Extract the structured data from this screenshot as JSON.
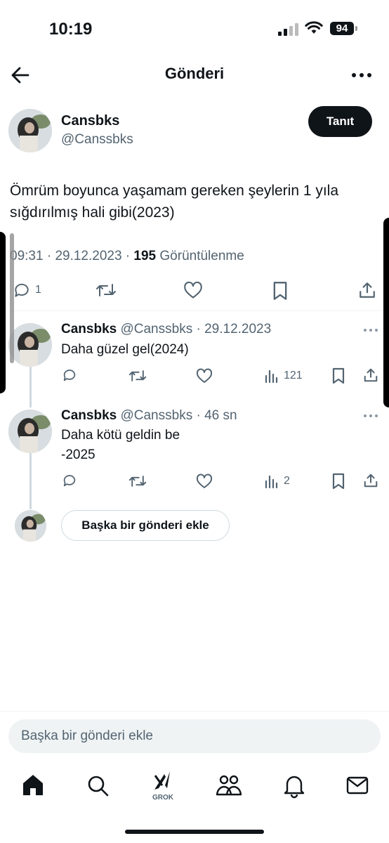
{
  "status_bar": {
    "time": "10:19",
    "battery": "94"
  },
  "header": {
    "title": "Gönderi"
  },
  "post": {
    "author_name": "Cansbks",
    "author_handle": "@Canssbks",
    "follow_label": "Tanıt",
    "text": "Ömrüm boyunca yaşamam gereken şeylerin 1 yıla sığdırılmış hali gibi(2023)",
    "time": "09:31",
    "date": "29.12.2023",
    "views_count": "195",
    "views_label": "Görüntülenme",
    "reply_count": "1"
  },
  "replies": [
    {
      "name": "Cansbks",
      "handle": "@Canssbks",
      "time": "29.12.2023",
      "text": "Daha güzel gel(2024)",
      "views": "121"
    },
    {
      "name": "Cansbks",
      "handle": "@Canssbks",
      "time": "46 sn",
      "text_line1": "Daha kötü geldin be",
      "text_line2": "-2025",
      "views": "2"
    }
  ],
  "add_post_label": "Başka bir gönderi ekle",
  "compose_placeholder": "Başka bir gönderi ekle",
  "tabbar": {
    "grok_label": "GROK"
  },
  "icons": [
    "back-arrow-icon",
    "more-icon",
    "reply-icon",
    "repost-icon",
    "like-icon",
    "bookmark-icon",
    "share-icon",
    "views-icon",
    "home-icon",
    "search-icon",
    "grok-icon",
    "communities-icon",
    "notifications-icon",
    "messages-icon"
  ]
}
